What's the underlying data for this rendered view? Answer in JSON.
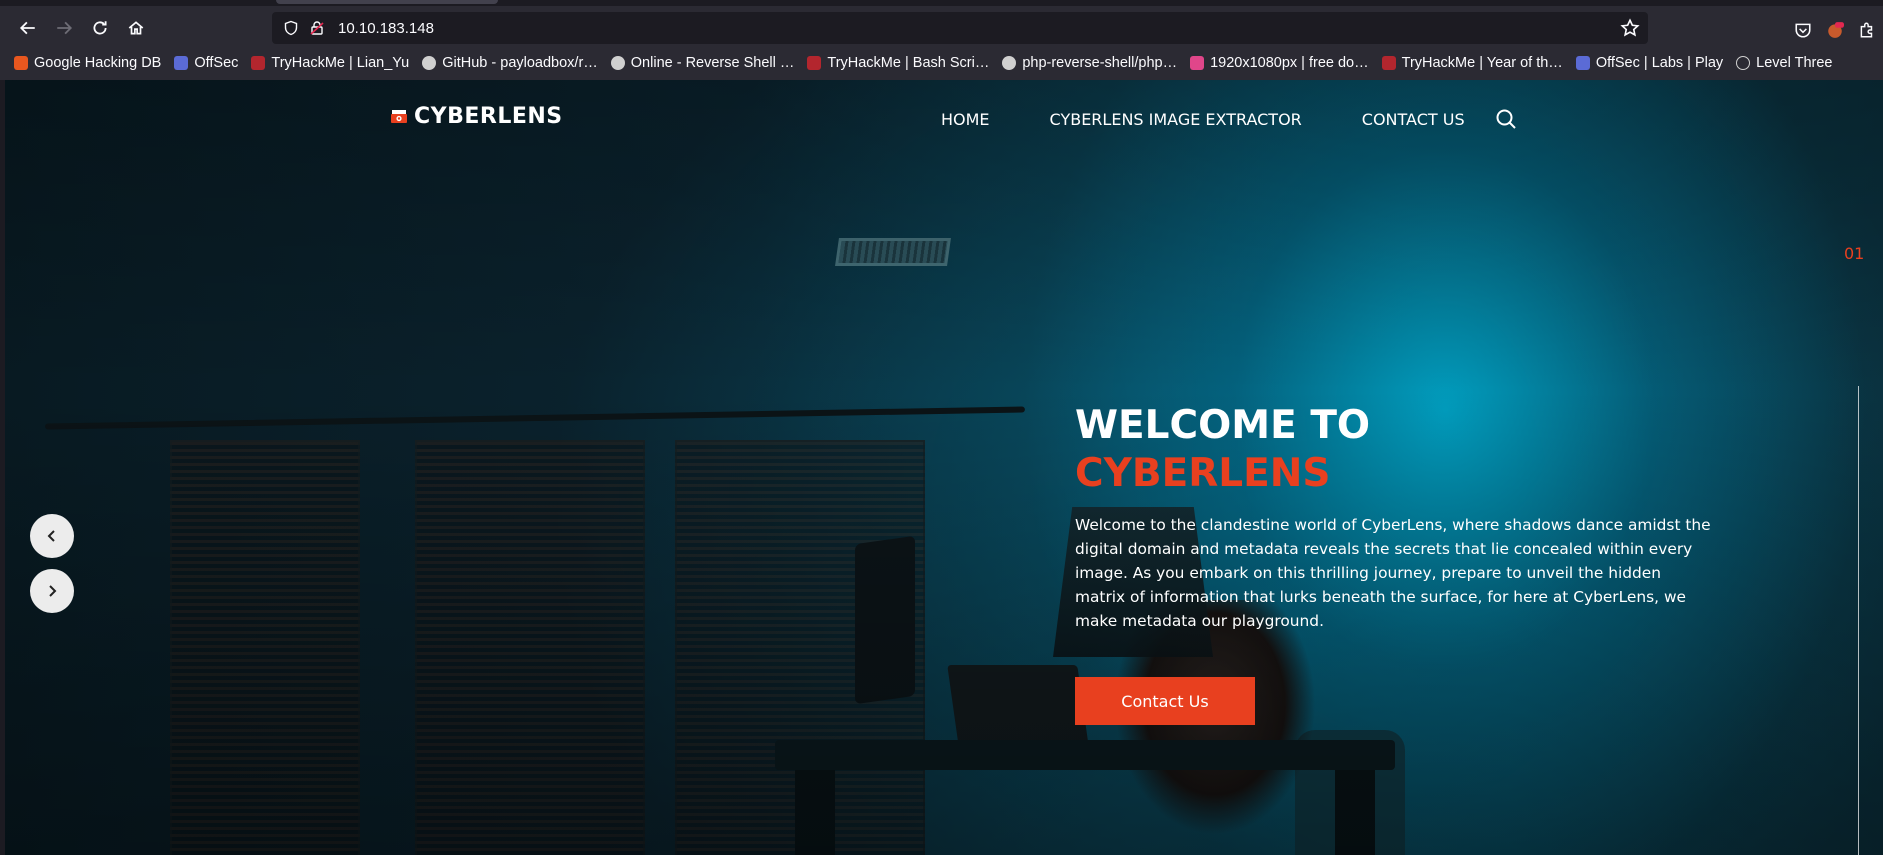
{
  "browser": {
    "url": "10.10.183.148",
    "bookmarks": [
      {
        "label": "Google Hacking DB",
        "color": "#e8571f"
      },
      {
        "label": "OffSec",
        "color": "#5b6bd6"
      },
      {
        "label": "TryHackMe | Lian_Yu",
        "color": "#b3262e"
      },
      {
        "label": "GitHub - payloadbox/r…",
        "color": "#d0d0d0"
      },
      {
        "label": "Online - Reverse Shell …",
        "color": "#d0d0d0"
      },
      {
        "label": "TryHackMe | Bash Scri…",
        "color": "#b3262e"
      },
      {
        "label": "php-reverse-shell/php…",
        "color": "#d0d0d0"
      },
      {
        "label": "1920x1080px | free do…",
        "color": "#e0468a"
      },
      {
        "label": "TryHackMe | Year of th…",
        "color": "#b3262e"
      },
      {
        "label": "OffSec | Labs | Play",
        "color": "#5b6bd6"
      },
      {
        "label": "Level Three",
        "color": "#d0d0d0"
      }
    ]
  },
  "site": {
    "logo": "CYBERLENS",
    "nav": {
      "home": "HOME",
      "extractor": "CYBERLENS IMAGE EXTRACTOR",
      "contact": "CONTACT US"
    },
    "slide_number": "01",
    "hero": {
      "title_line1": "WELCOME TO",
      "title_line2": "CYBERLENS",
      "body": "Welcome to the clandestine world of CyberLens, where shadows dance amidst the digital domain and metadata reveals the secrets that lie concealed within every image. As you embark on this thrilling journey, prepare to unveil the hidden matrix of information that lurks beneath the surface, for here at CyberLens, we make metadata our playground.",
      "cta": "Contact Us"
    }
  },
  "colors": {
    "accent": "#e8401f",
    "browser_bg": "#2b2a33"
  },
  "icons": {
    "back": "arrow-left-icon",
    "forward": "arrow-right-icon",
    "reload": "reload-icon",
    "home": "home-icon",
    "shield": "shield-icon",
    "lock": "insecure-lock-icon",
    "bookmark_star": "star-icon",
    "pocket": "pocket-icon",
    "extensions": "puzzle-icon",
    "search": "search-icon",
    "prev": "chevron-left-icon",
    "next": "chevron-right-icon"
  }
}
